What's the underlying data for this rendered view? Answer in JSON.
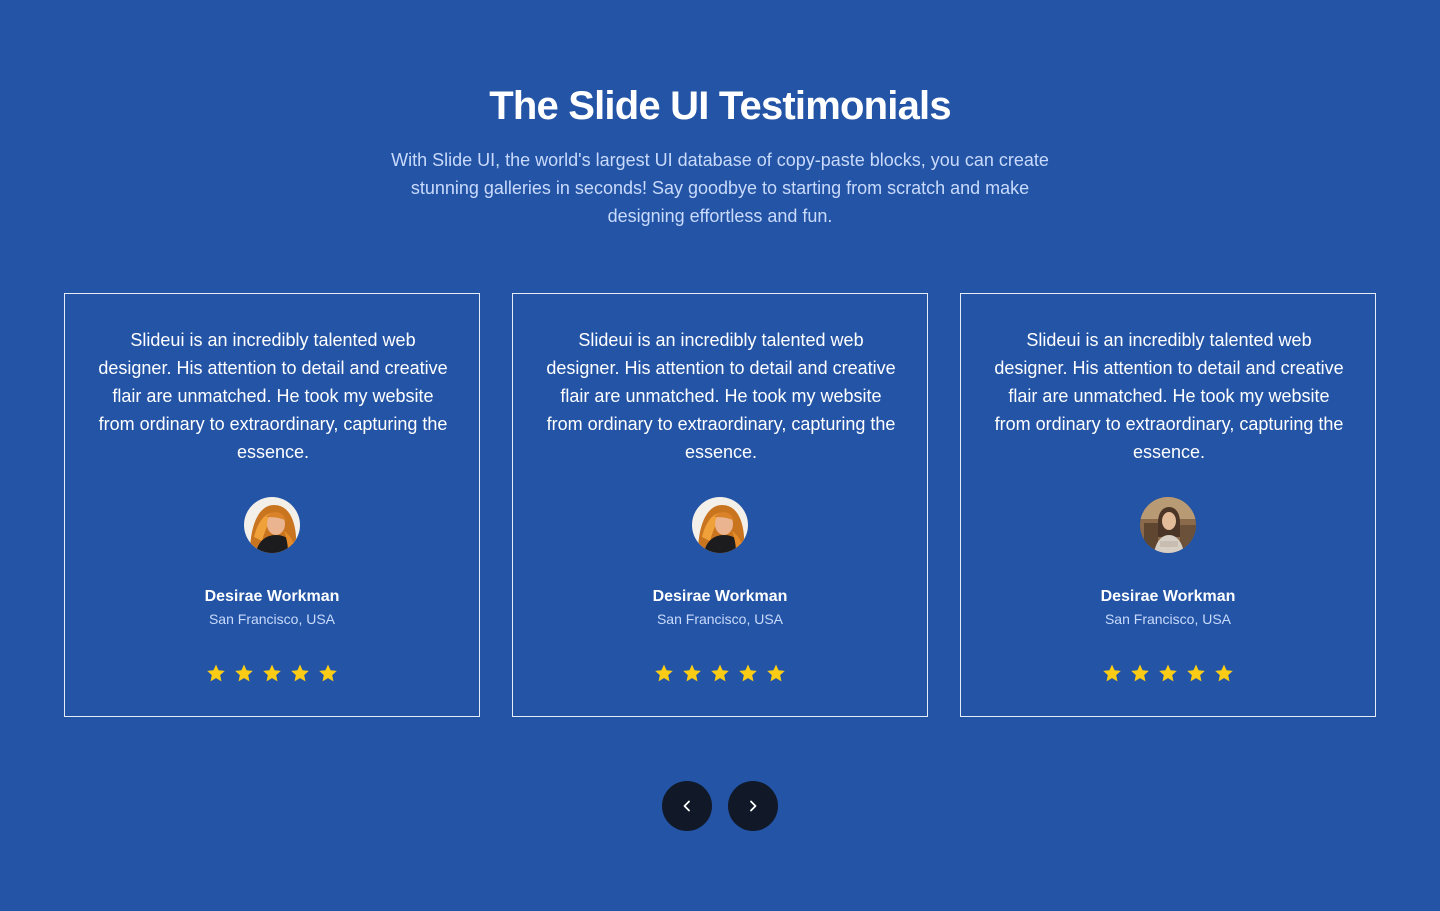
{
  "header": {
    "title": "The Slide UI Testimonials",
    "subtitle": "With Slide UI, the world's largest UI database of copy-paste blocks, you can create stunning galleries in seconds! Say goodbye to starting from scratch and make designing effortless and fun."
  },
  "testimonials": [
    {
      "quote": "Slideui is an incredibly talented web designer. His attention to detail and creative flair are unmatched. He took my website from ordinary to extraordinary, capturing the essence.",
      "name": "Desirae Workman",
      "location": "San Francisco, USA",
      "rating": 5,
      "avatar_icon": "avatar-photo-woman-golden-hair"
    },
    {
      "quote": "Slideui is an incredibly talented web designer. His attention to detail and creative flair are unmatched. He took my website from ordinary to extraordinary, capturing the essence.",
      "name": "Desirae Workman",
      "location": "San Francisco, USA",
      "rating": 5,
      "avatar_icon": "avatar-photo-woman-golden-hair"
    },
    {
      "quote": "Slideui is an incredibly talented web designer. His attention to detail and creative flair are unmatched. He took my website from ordinary to extraordinary, capturing the essence.",
      "name": "Desirae Workman",
      "location": "San Francisco, USA",
      "rating": 5,
      "avatar_icon": "avatar-photo-woman-indoor"
    }
  ],
  "navigation": {
    "prev_icon": "chevron-left-icon",
    "next_icon": "chevron-right-icon"
  },
  "colors": {
    "background": "#2354a6",
    "card_border": "#e6ecf7",
    "subtitle_text": "#c9dafc",
    "star": "#facc15",
    "nav_button": "#111827"
  }
}
